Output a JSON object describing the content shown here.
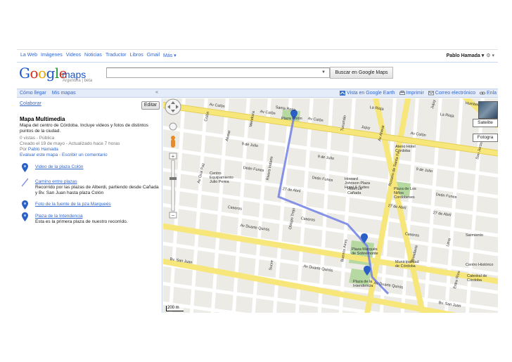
{
  "topnav": {
    "items": [
      "La Web",
      "Imágenes",
      "Videos",
      "Noticias",
      "Traductor",
      "Libros",
      "Gmail",
      "Más ▾"
    ],
    "user": "Pablo Hamada ▾",
    "settings": "⚙ ▾"
  },
  "header": {
    "logo_maps": "maps",
    "logo_sub": "Argentina | beta",
    "search_value": "",
    "search_button": "Buscar en Google Maps"
  },
  "toolbar": {
    "left": [
      "Cómo llegar",
      "Mis mapas"
    ],
    "collapse": "«",
    "right": [
      {
        "label": "Vista en Google Earth",
        "icon": "earth-icon"
      },
      {
        "label": "Imprimir",
        "icon": "print-icon"
      },
      {
        "label": "Correo electrónico",
        "icon": "email-icon"
      },
      {
        "label": "Enla",
        "icon": "link-icon"
      }
    ]
  },
  "panel": {
    "colaborar": "Colaborar",
    "editar": "Editar",
    "title": "Mapa Multimedia",
    "description": "Mapa del centro de Córdoba. Incluye videos y fotos de distintos puntos de la ciudad.",
    "views": "0 vistas - Pública",
    "created": "Creado el 19 de mayo - Actualizado hace 7 horas",
    "author_prefix": "Por ",
    "author": "Pablo Hamada",
    "evaluate": "Evaluar este mapa",
    "sep": " - ",
    "comment": "Escribir un comentario",
    "features": [
      {
        "title": "Video de la plaza Colón",
        "desc": "",
        "type": "placemark"
      },
      {
        "title": "Camino entre plazas",
        "desc": "Recorrido por las plazas de Alberdi, partiendo desde Cañada y Bv. San Juan hasta plaza Colón",
        "type": "line"
      },
      {
        "title": "Foto de la fuente de la pza Marqueés",
        "desc": "",
        "type": "placemark"
      },
      {
        "title": "Plaza de la Intendencia",
        "desc": "Esta es la primera plaza de nuestro recorrido.",
        "type": "placemark"
      }
    ]
  },
  "map": {
    "satellite": "Satelite",
    "photos": "Fotogra",
    "scale": "200 m",
    "street_labels": [
      "Av Colón",
      "Av Colón",
      "Av Colón",
      "Av Colón",
      "La Rioja",
      "La Rioja",
      "Jujuy",
      "Av Alvear",
      "Santa Rosa",
      "9 de Julio",
      "9 de Julio",
      "9 de Julio",
      "Deán Funes",
      "Deán Funes",
      "Deán Funes",
      "27 de Abril",
      "27 de Abril",
      "27 de Abril",
      "Caseros",
      "Caseros",
      "Caseros",
      "Av Duarte Quirós",
      "Av Duarte Quirós",
      "Av Duarte Quirós",
      "Bv. San Juan",
      "Bv. San Juan",
      "Colón",
      "Alvear",
      "Av Gral Paz",
      "Rivera Indarte",
      "Obispo Trejo",
      "Sucre",
      "Buenos Aires",
      "Entre Ríos",
      "San Jerónimo",
      "Rosario de Santa Fe",
      "Mendoza",
      "Tucumán",
      "Jujuy",
      "Lima",
      "Rivadavia",
      "Humberto Primo"
    ],
    "places": [
      "Plaza Colón",
      "Plaza Marqués de Sobremonte",
      "Plaza de la Intendencia",
      "Plaza de Los Niños Cordobeses",
      "Howard Johnson Plaza Hotel & Suites",
      "Hotel La Cañada",
      "Ateno Hotel Córdoba",
      "Centro Equipamiento Julio Perea",
      "Municipalidad de Córdoba",
      "Centro Histórico",
      "Catedral de Córdoba",
      "Sarmiento"
    ]
  }
}
